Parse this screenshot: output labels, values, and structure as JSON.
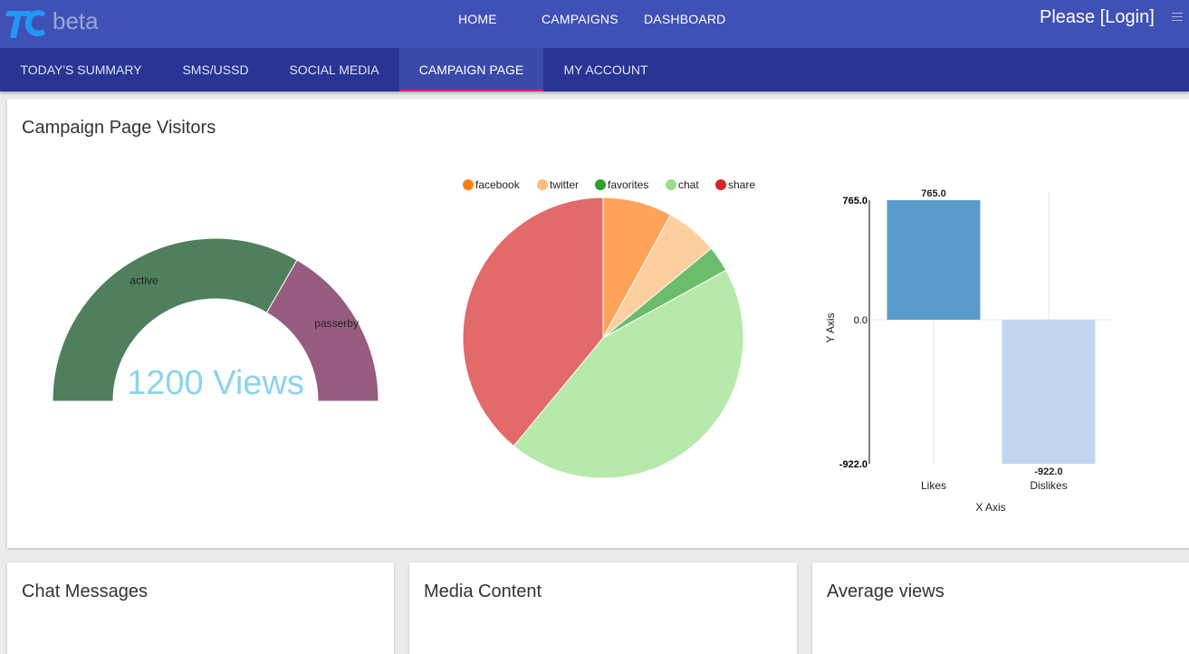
{
  "brand": {
    "logo_suffix": "beta",
    "accent": "#2196f3"
  },
  "topnav": {
    "home": "HOME",
    "campaigns": "CAMPAIGNS",
    "dashboard": "DASHBOARD",
    "login": "Please [Login]",
    "menu_icon": "hamburger-icon"
  },
  "tabs": [
    {
      "label": "TODAY'S SUMMARY",
      "active": false
    },
    {
      "label": "SMS/USSD",
      "active": false
    },
    {
      "label": "SOCIAL MEDIA",
      "active": false
    },
    {
      "label": "CAMPAIGN PAGE",
      "active": true
    },
    {
      "label": "MY ACCOUNT",
      "active": false
    }
  ],
  "visitors_card": {
    "title": "Campaign Page Visitors"
  },
  "chart_data": [
    {
      "type": "pie",
      "variant": "half-donut gauge",
      "center_label": "1200 Views",
      "slices": [
        {
          "label": "active",
          "value": 800,
          "color": "#4f7f5d"
        },
        {
          "label": "passerby",
          "value": 400,
          "color": "#965d80"
        }
      ]
    },
    {
      "type": "pie",
      "legend_position": "top",
      "slices": [
        {
          "label": "facebook",
          "value": 8,
          "color": "#ffa35a"
        },
        {
          "label": "twitter",
          "value": 6,
          "color": "#ffce9f"
        },
        {
          "label": "favorites",
          "value": 3,
          "color": "#6bbd6b"
        },
        {
          "label": "chat",
          "value": 44,
          "color": "#b7e9aa"
        },
        {
          "label": "share",
          "value": 39,
          "color": "#e26a6a"
        }
      ],
      "legend_colors": [
        "#ff7f0e",
        "#ffbb78",
        "#2ca02c",
        "#98df8a",
        "#d62728"
      ]
    },
    {
      "type": "bar",
      "categories": [
        "Likes",
        "Dislikes"
      ],
      "values": [
        765.0,
        -922.0
      ],
      "value_labels": [
        "765.0",
        "-922.0"
      ],
      "colors": [
        "#5a9bcb",
        "#c2d6ef"
      ],
      "xlabel": "X Axis",
      "ylabel": "Y Axis",
      "ylim": [
        -922.0,
        765.0
      ],
      "yticks": [
        "765.0",
        "0.0",
        "-922.0"
      ]
    }
  ],
  "bottom_cards": [
    {
      "title": "Chat Messages"
    },
    {
      "title": "Media Content"
    },
    {
      "title": "Average views"
    }
  ]
}
